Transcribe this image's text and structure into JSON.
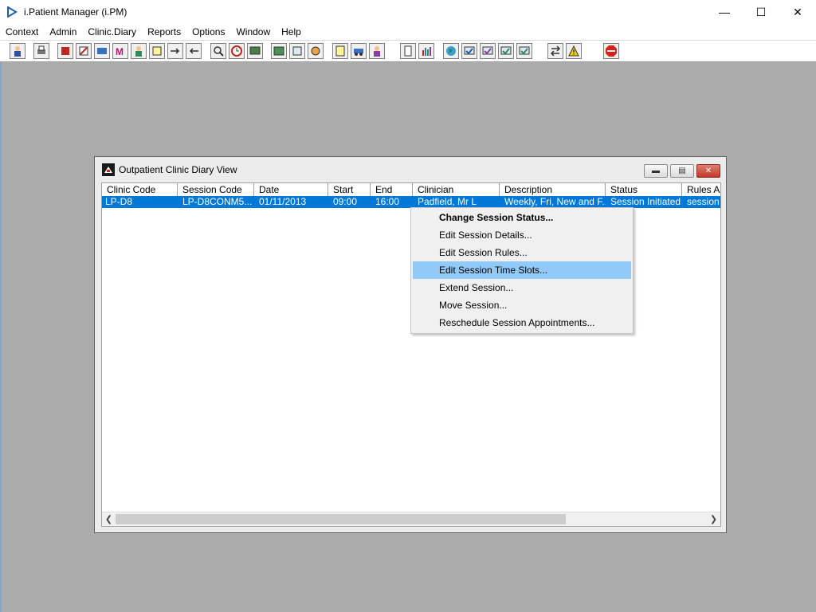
{
  "window": {
    "title": "i.Patient Manager (i.PM)"
  },
  "menu": [
    "Context",
    "Admin",
    "Clinic.Diary",
    "Reports",
    "Options",
    "Window",
    "Help"
  ],
  "toolbar_icons": [
    "patient-icon",
    "printer-icon",
    "book-icon",
    "edit-icon",
    "card-icon",
    "m-icon",
    "doctor-icon",
    "note-icon",
    "arrow-icon",
    "arrow2-icon",
    "search-icon",
    "clock-icon",
    "screen-icon",
    "photo-icon",
    "form-icon",
    "dial-icon",
    "doc-yellow-icon",
    "ambulance-icon",
    "person-icon",
    "page-icon",
    "chart-icon",
    "globe-icon",
    "check-icon",
    "check2-icon",
    "check3-icon",
    "check4-icon",
    "swap-icon",
    "warning-icon",
    "exit-icon"
  ],
  "child": {
    "title": "Outpatient Clinic Diary View"
  },
  "grid": {
    "columns": [
      "Clinic Code",
      "Session Code",
      "Date",
      "Start",
      "End",
      "Clinician",
      "Description",
      "Status",
      "Rules Ap"
    ],
    "row": [
      "LP-D8",
      "LP-D8CONM5...",
      "01/11/2013",
      "09:00",
      "16:00",
      "Padfield, Mr L",
      "Weekly, Fri, New and F...",
      "Session Initiated",
      "session"
    ]
  },
  "context_menu": [
    "Change Session Status...",
    "Edit Session Details...",
    "Edit Session Rules...",
    "Edit Session Time Slots...",
    "Extend Session...",
    "Move Session...",
    "Reschedule Session Appointments..."
  ],
  "colors": {
    "selection": "#0078d7",
    "menu_highlight": "#91c9f7",
    "desktop": "#ababab"
  }
}
